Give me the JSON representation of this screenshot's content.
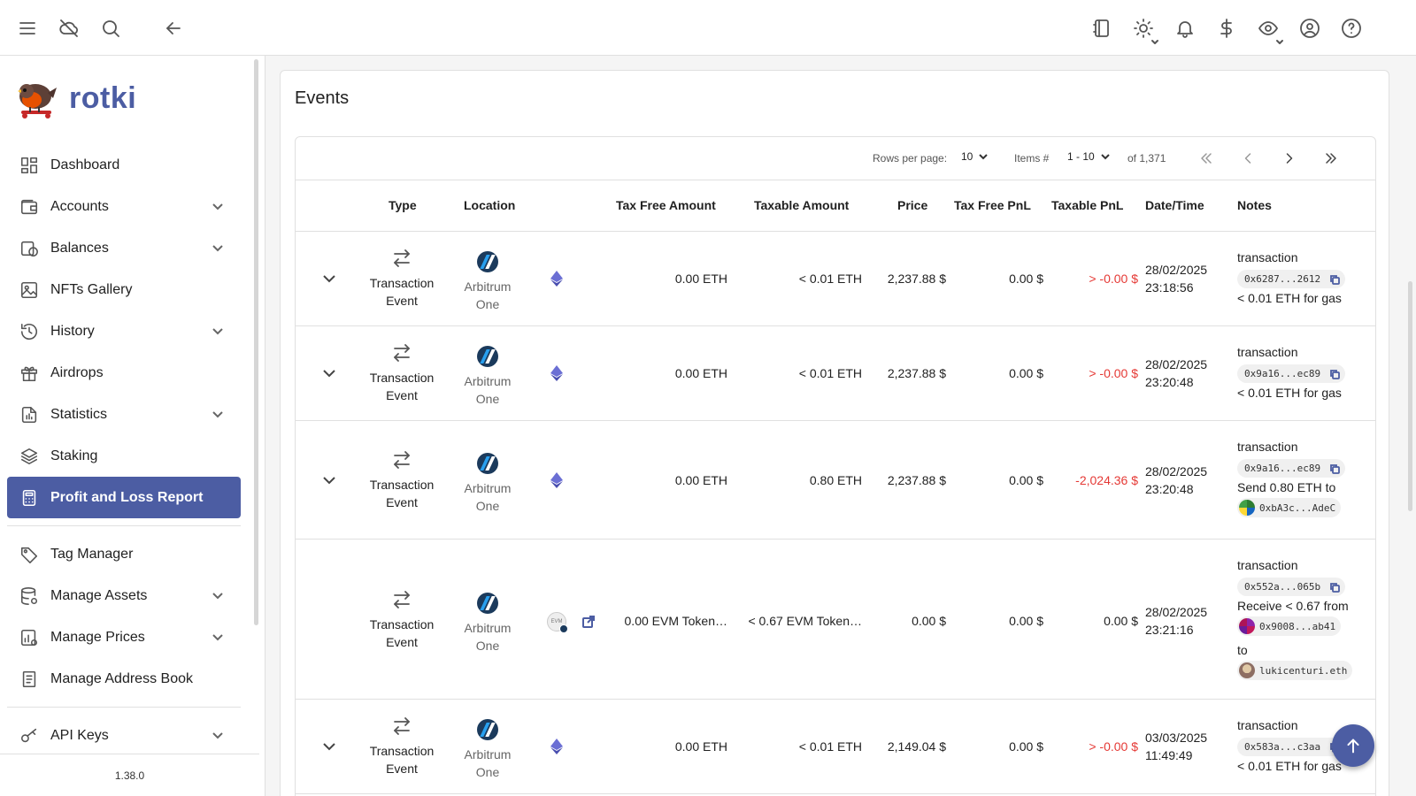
{
  "app": {
    "name": "rotki",
    "version": "1.38.0"
  },
  "topbar": {
    "icons": [
      "menu-icon",
      "cloud-off-icon",
      "search-icon",
      "back-arrow-icon",
      "notes-icon",
      "theme-icon",
      "bell-icon",
      "currency-icon",
      "eye-icon",
      "account-icon",
      "help-icon"
    ]
  },
  "sidebar": {
    "items": [
      {
        "label": "Dashboard",
        "icon": "dashboard-icon",
        "expandable": false
      },
      {
        "label": "Accounts",
        "icon": "wallet-icon",
        "expandable": true
      },
      {
        "label": "Balances",
        "icon": "coins-icon",
        "expandable": true
      },
      {
        "label": "NFTs Gallery",
        "icon": "image-icon",
        "expandable": false
      },
      {
        "label": "History",
        "icon": "history-icon",
        "expandable": true
      },
      {
        "label": "Airdrops",
        "icon": "gift-icon",
        "expandable": false
      },
      {
        "label": "Statistics",
        "icon": "chart-file-icon",
        "expandable": true
      },
      {
        "label": "Staking",
        "icon": "layers-icon",
        "expandable": false
      },
      {
        "label": "Profit and Loss Report",
        "icon": "calculator-icon",
        "expandable": false,
        "active": true
      }
    ],
    "items2": [
      {
        "label": "Tag Manager",
        "icon": "tag-icon",
        "expandable": false
      },
      {
        "label": "Manage Assets",
        "icon": "database-icon",
        "expandable": true
      },
      {
        "label": "Manage Prices",
        "icon": "price-icon",
        "expandable": true
      },
      {
        "label": "Manage Address Book",
        "icon": "book-icon",
        "expandable": false
      },
      {
        "label": "API Keys",
        "icon": "key-icon",
        "expandable": true
      }
    ]
  },
  "main": {
    "title": "Events",
    "pager": {
      "rows_per_page_label": "Rows per page:",
      "rows_per_page": "10",
      "items_label": "Items #",
      "items_range": "1 - 10",
      "total": "of 1,371"
    },
    "columns": [
      "Type",
      "Location",
      "Tax Free Amount",
      "Taxable Amount",
      "Price",
      "Tax Free PnL",
      "Taxable PnL",
      "Date/Time",
      "Notes"
    ],
    "rows": [
      {
        "type": "Transaction Event",
        "location": "Arbitrum One",
        "asset_icon": "eth-icon",
        "tax_free_amount": "0.00 ETH",
        "taxable_amount": "< 0.01 ETH",
        "price": "2,237.88 $",
        "tax_free_pnl": "0.00 $",
        "taxable_pnl": "> -0.00 $",
        "date": "28/02/2025",
        "time": "23:18:56",
        "note1": "transaction",
        "hash": "0x6287...2612",
        "note2": "< 0.01 ETH for gas"
      },
      {
        "type": "Transaction Event",
        "location": "Arbitrum One",
        "asset_icon": "eth-icon",
        "tax_free_amount": "0.00 ETH",
        "taxable_amount": "< 0.01 ETH",
        "price": "2,237.88 $",
        "tax_free_pnl": "0.00 $",
        "taxable_pnl": "> -0.00 $",
        "date": "28/02/2025",
        "time": "23:20:48",
        "note1": "transaction",
        "hash": "0x9a16...ec89",
        "note2": "< 0.01 ETH for gas"
      },
      {
        "type": "Transaction Event",
        "location": "Arbitrum One",
        "asset_icon": "eth-icon",
        "tax_free_amount": "0.00 ETH",
        "taxable_amount": "0.80 ETH",
        "price": "2,237.88 $",
        "tax_free_pnl": "0.00 $",
        "taxable_pnl": "-2,024.36 $",
        "date": "28/02/2025",
        "time": "23:20:48",
        "note1": "transaction",
        "hash": "0x9a16...ec89",
        "note2": "Send 0.80 ETH to",
        "address": "0xbA3c...AdeC"
      },
      {
        "type": "Transaction Event",
        "location": "Arbitrum One",
        "asset_icon": "evm-token-icon",
        "asset_badge": "EVM",
        "tax_free_amount": "0.00 EVM Token…",
        "taxable_amount": "< 0.67 EVM Token…",
        "price": "0.00 $",
        "tax_free_pnl": "0.00 $",
        "taxable_pnl": "0.00 $",
        "date": "28/02/2025",
        "time": "23:21:16",
        "note1": "transaction",
        "hash": "0x552a...065b",
        "note2": "Receive < 0.67 from",
        "address": "0x9008...ab41",
        "note3": "to",
        "address2": "lukicenturi.eth"
      },
      {
        "type": "Transaction Event",
        "location": "Arbitrum One",
        "asset_icon": "eth-icon",
        "tax_free_amount": "0.00 ETH",
        "taxable_amount": "< 0.01 ETH",
        "price": "2,149.04 $",
        "tax_free_pnl": "0.00 $",
        "taxable_pnl": "> -0.00 $",
        "date": "03/03/2025",
        "time": "11:49:49",
        "note1": "transaction",
        "hash": "0x583a...c3aa",
        "note2": "< 0.01 ETH for gas"
      }
    ]
  },
  "colors": {
    "brand": "#4c5da3",
    "negative": "#e53935"
  }
}
